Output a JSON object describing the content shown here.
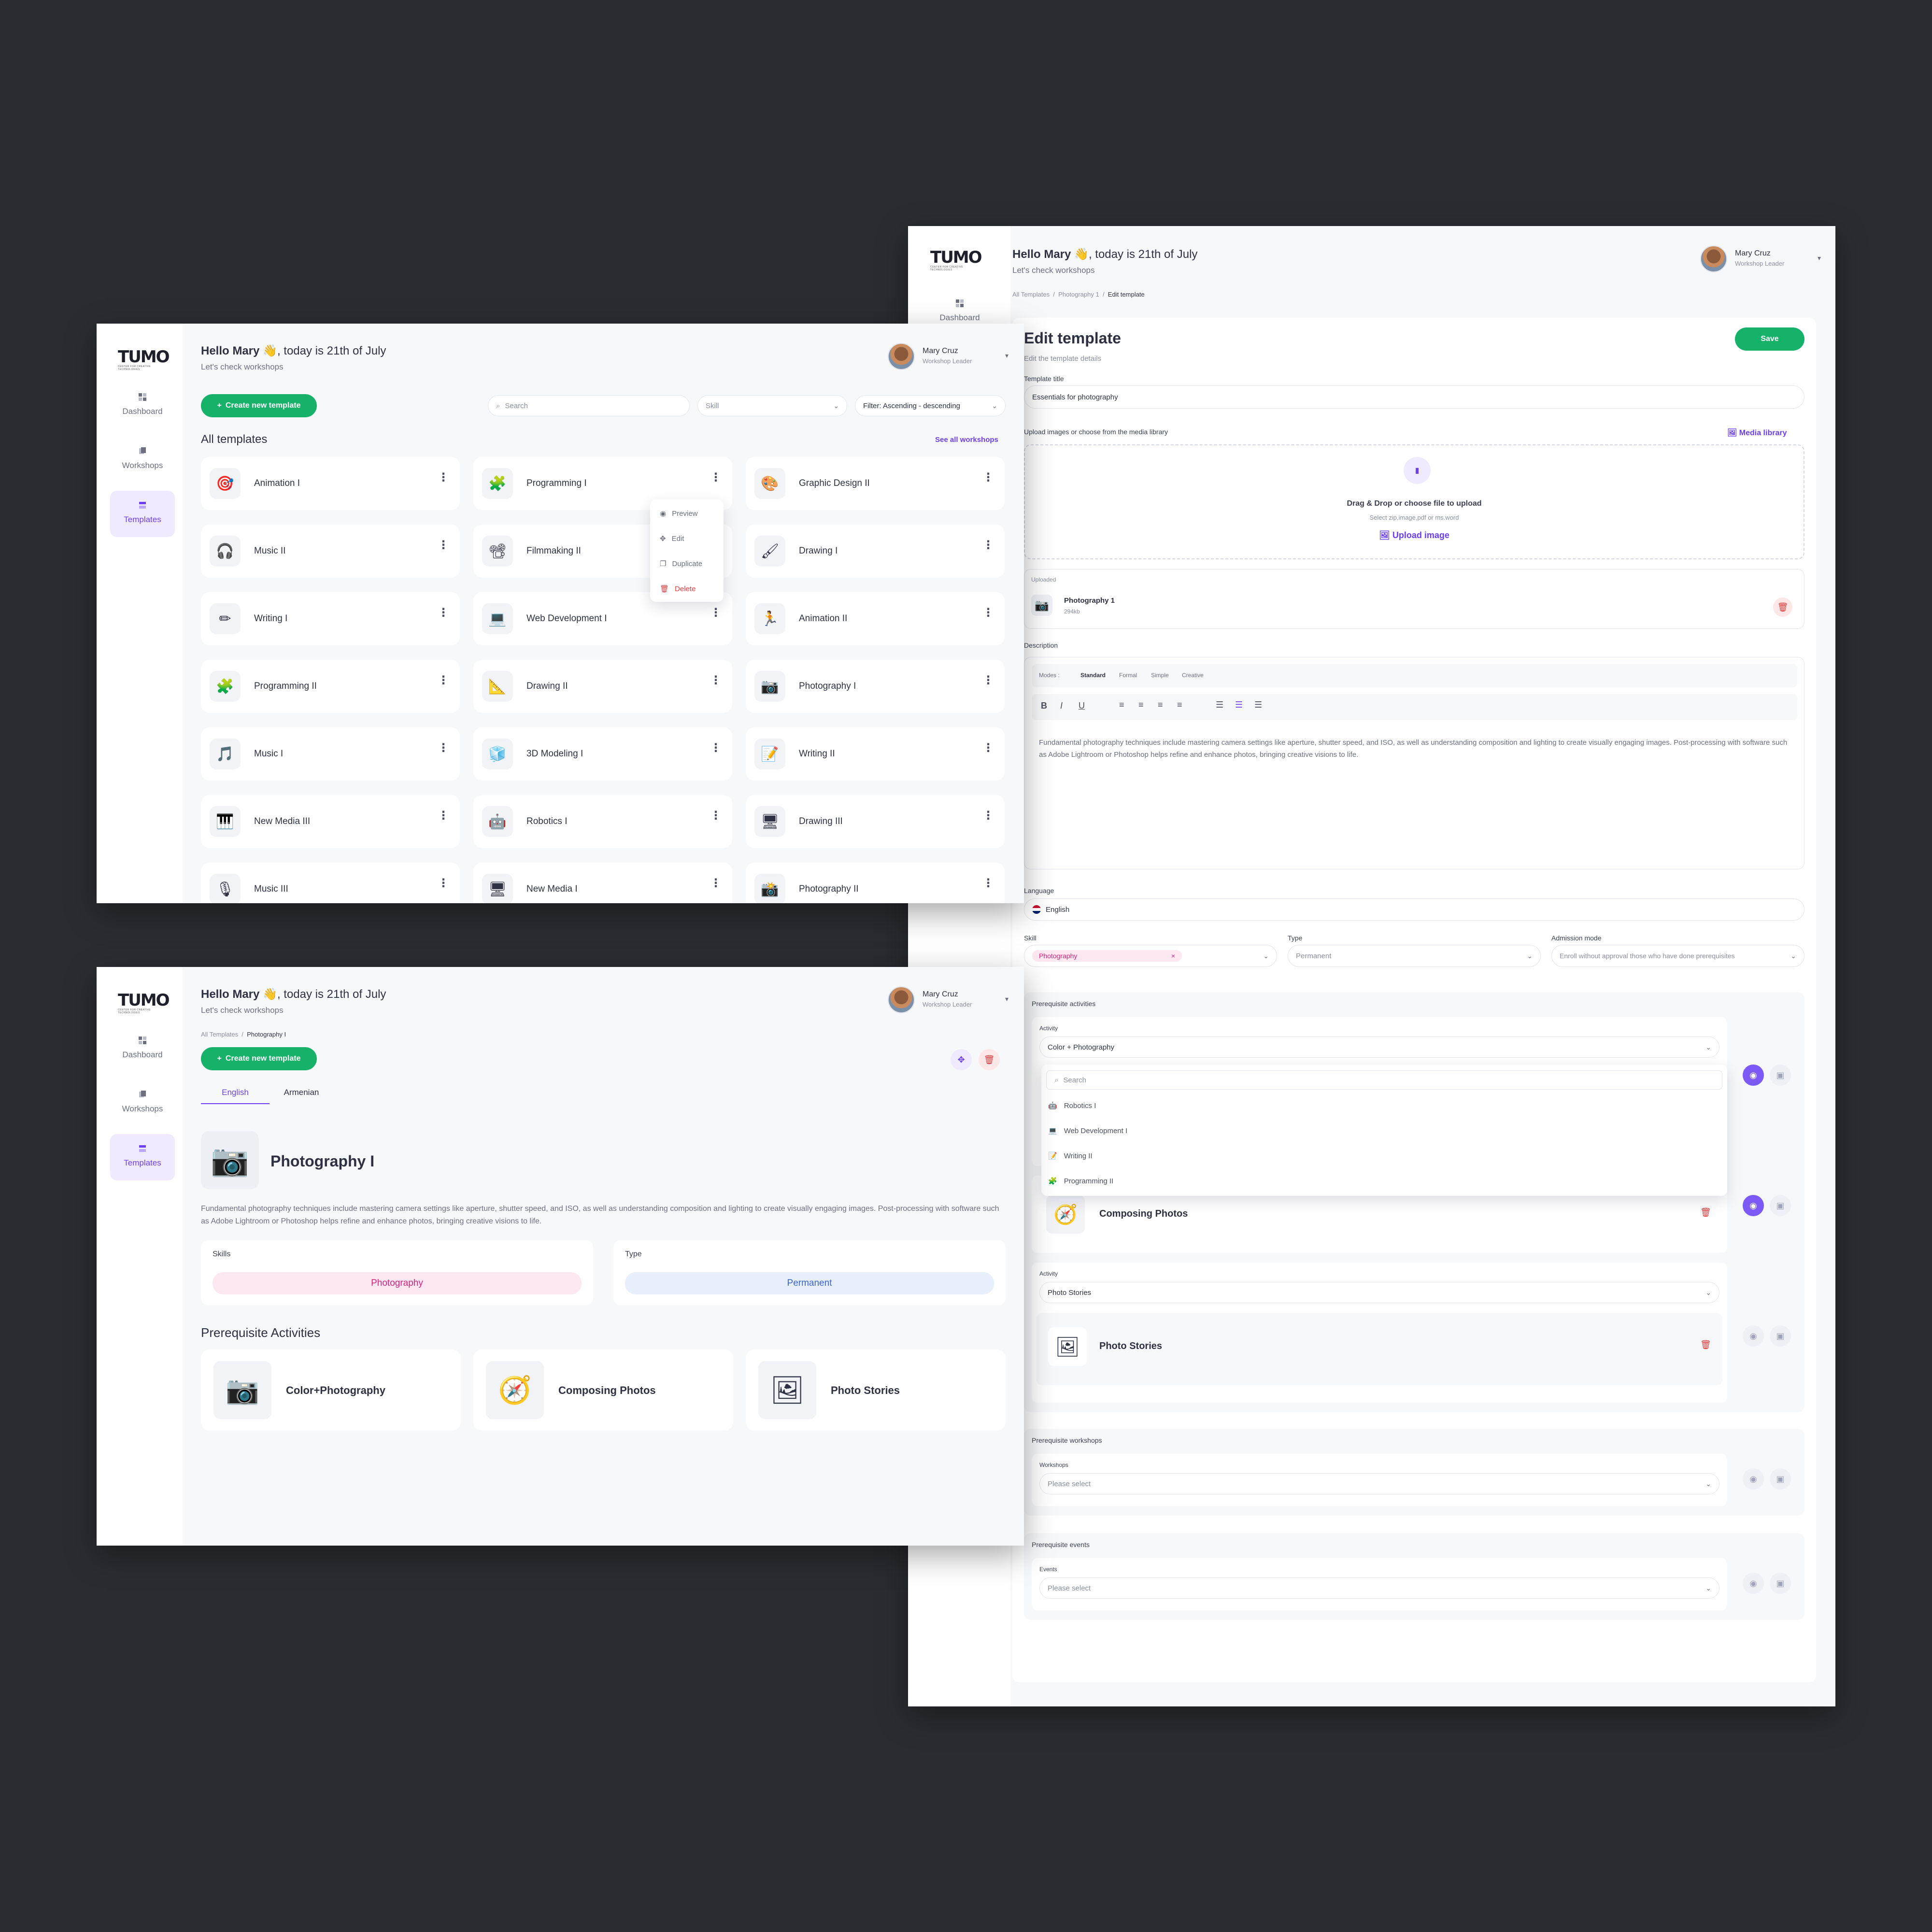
{
  "brand": {
    "logo_word": "TUMO",
    "logo_tagline": "CENTER FOR CREATIVE TECHNOLOGIES"
  },
  "sidebar": {
    "items": [
      {
        "label": "Dashboard"
      },
      {
        "label": "Workshops"
      },
      {
        "label": "Templates"
      }
    ]
  },
  "greeting": {
    "hello": "Hello Mary",
    "wave": "👋",
    "date_text": ", today is 21th of July",
    "subtitle": "Let's check workshops"
  },
  "user": {
    "name": "Mary Cruz",
    "role": "Workshop Leader"
  },
  "templates_page": {
    "create_button": "Create new template",
    "search_placeholder": "Search",
    "skill_placeholder": "Skill",
    "filter_label": "Filter: Ascending - descending",
    "section_title": "All templates",
    "see_all": "See all workshops",
    "cards": [
      {
        "title": "Animation I",
        "icon": "🎯"
      },
      {
        "title": "Programming I",
        "icon": "🧩"
      },
      {
        "title": "Graphic Design II",
        "icon": "🎨"
      },
      {
        "title": "Music II",
        "icon": "🎧"
      },
      {
        "title": "Filmmaking II",
        "icon": "📽"
      },
      {
        "title": "Drawing I",
        "icon": "🖌"
      },
      {
        "title": "Writing I",
        "icon": "✏"
      },
      {
        "title": "Web Development I",
        "icon": "💻"
      },
      {
        "title": "Animation II",
        "icon": "🏃"
      },
      {
        "title": "Programming II",
        "icon": "🧩"
      },
      {
        "title": "Drawing II",
        "icon": "📐"
      },
      {
        "title": "Photography I",
        "icon": "📷"
      },
      {
        "title": "Music I",
        "icon": "🎵"
      },
      {
        "title": "3D Modeling I",
        "icon": "🧊"
      },
      {
        "title": "Writing II",
        "icon": "📝"
      },
      {
        "title": "New Media III",
        "icon": "🎹"
      },
      {
        "title": "Robotics I",
        "icon": "🤖"
      },
      {
        "title": "Drawing III",
        "icon": "🖥"
      },
      {
        "title": "Music III",
        "icon": "🎙"
      },
      {
        "title": "New Media I",
        "icon": "🖥"
      },
      {
        "title": "Photography II",
        "icon": "📸"
      }
    ],
    "context_menu": [
      "Preview",
      "Edit",
      "Duplicate",
      "Delete"
    ]
  },
  "detail_page": {
    "breadcrumb": [
      "All Templates",
      "Photography I"
    ],
    "create_button": "Create new template",
    "tabs": [
      "English",
      "Armenian"
    ],
    "title": "Photography I",
    "description": "Fundamental photography techniques include mastering camera settings like aperture, shutter speed, and ISO, as well as understanding composition and lighting to create visually engaging images. Post-processing with software such as Adobe Lightroom or Photoshop helps refine and enhance photos, bringing creative visions to life.",
    "skills_label": "Skills",
    "skill": "Photography",
    "type_label": "Type",
    "type": "Permanent",
    "prereq_title": "Prerequisite Activities",
    "activities": [
      {
        "title": "Color+Photography",
        "icon": "📷"
      },
      {
        "title": "Composing Photos",
        "icon": "🧭"
      },
      {
        "title": "Photo Stories",
        "icon": "🖼"
      }
    ]
  },
  "edit_page": {
    "breadcrumb": [
      "All Templates",
      "Photography 1",
      "Edit template"
    ],
    "title": "Edit template",
    "subtitle": "Edit the template details",
    "save": "Save",
    "template_title_label": "Template title",
    "template_title_value": "Essentials for photography",
    "upload_label": "Upload images or choose from the media library",
    "media_library": "Media library",
    "drop_title": "Drag & Drop or choose file to upload",
    "drop_sub": "Select zip,image,pdf or ms.word",
    "upload_image": "Upload image",
    "uploaded_label": "Uploaded",
    "uploaded_file": "Photography 1",
    "uploaded_size": "294kb",
    "description_label": "Description",
    "modes_label": "Modes :",
    "modes": [
      "Standard",
      "Formal",
      "Simple",
      "Creative"
    ],
    "description": "Fundamental photography techniques include mastering camera settings like aperture, shutter speed, and ISO, as well as understanding composition and lighting to create visually engaging images. Post-processing with software such as Adobe Lightroom or Photoshop helps refine and enhance photos, bringing creative visions to life.",
    "language_label": "Language",
    "language": "English",
    "skill_label": "Skill",
    "skill": "Photography",
    "type_label": "Type",
    "type": "Permanent",
    "admission_label": "Admission mode",
    "admission": "Enroll without approval those who have done prerequisites",
    "prereq_activities": "Prerequisite activities",
    "activity_label": "Activity",
    "activity1": "Color + Photography",
    "search_placeholder": "Search",
    "dropdown": [
      "Robotics I",
      "Web Development I",
      "Writing II",
      "Programming II"
    ],
    "composing": "Composing Photos",
    "activity3": "Photo Stories",
    "photo_stories": "Photo Stories",
    "prereq_workshops": "Prerequisite workshops",
    "workshops_label": "Workshops",
    "please_select": "Please select",
    "prereq_events": "Prerequisite events",
    "events_label": "Events"
  }
}
